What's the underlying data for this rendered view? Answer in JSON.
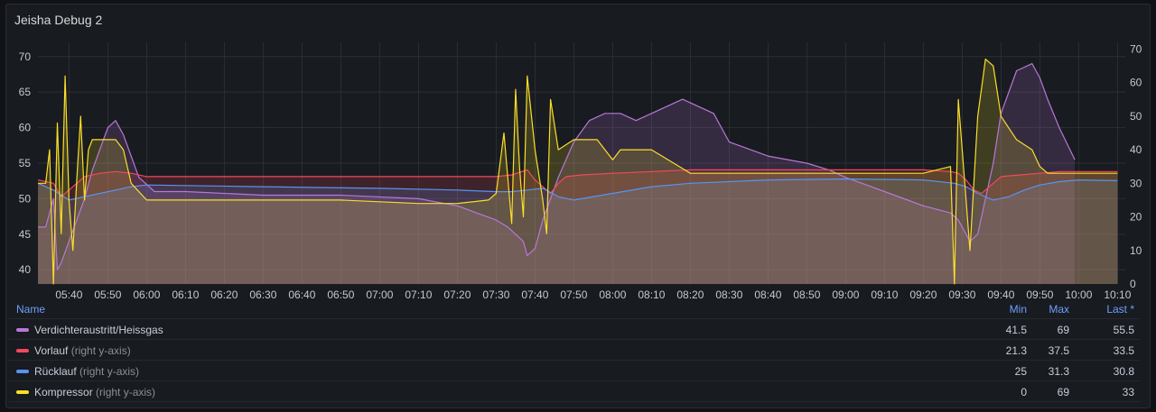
{
  "panel": {
    "title": "Jeisha Debug 2"
  },
  "legend": {
    "headers": {
      "name": "Name",
      "min": "Min",
      "max": "Max",
      "last": "Last *"
    },
    "rows": [
      {
        "name": "Verdichteraustritt/Heissgas",
        "axis_note": "",
        "color": "#b877d9",
        "min": "41.5",
        "max": "69",
        "last": "55.5"
      },
      {
        "name": "Vorlauf",
        "axis_note": "(right y-axis)",
        "color": "#f2495c",
        "min": "21.3",
        "max": "37.5",
        "last": "33.5"
      },
      {
        "name": "Rücklauf",
        "axis_note": "(right y-axis)",
        "color": "#5794f2",
        "min": "25",
        "max": "31.3",
        "last": "30.8"
      },
      {
        "name": "Kompressor",
        "axis_note": "(right y-axis)",
        "color": "#fade2a",
        "min": "0",
        "max": "69",
        "last": "33"
      }
    ]
  },
  "chart_data": {
    "type": "line",
    "grid": true,
    "legend_placement": "bottom",
    "xlim": [
      "05:32",
      "10:12"
    ],
    "x_ticks": [
      "05:40",
      "05:50",
      "06:00",
      "06:10",
      "06:20",
      "06:30",
      "06:40",
      "06:50",
      "07:00",
      "07:10",
      "07:20",
      "07:30",
      "07:40",
      "07:50",
      "08:00",
      "08:10",
      "08:20",
      "08:30",
      "08:40",
      "08:50",
      "09:00",
      "09:10",
      "09:20",
      "09:30",
      "09:40",
      "09:50",
      "10:00",
      "10:10"
    ],
    "y_left": {
      "ylim": [
        38,
        72
      ],
      "ticks": [
        "40",
        "45",
        "50",
        "55",
        "60",
        "65",
        "70"
      ]
    },
    "y_right": {
      "ylim": [
        0,
        72
      ],
      "ticks": [
        "0",
        "10",
        "20",
        "30",
        "40",
        "50",
        "60",
        "70"
      ]
    },
    "series": [
      {
        "name": "Verdichteraustritt/Heissgas",
        "axis": "left",
        "color": "#b877d9",
        "x": [
          "05:32",
          "05:34",
          "05:36",
          "05:37",
          "05:38",
          "05:40",
          "05:42",
          "05:44",
          "05:46",
          "05:48",
          "05:50",
          "05:52",
          "05:54",
          "05:56",
          "05:58",
          "06:00",
          "06:02",
          "06:10",
          "06:30",
          "06:50",
          "07:10",
          "07:20",
          "07:25",
          "07:30",
          "07:33",
          "07:35",
          "07:37",
          "07:38",
          "07:40",
          "07:42",
          "07:44",
          "07:46",
          "07:50",
          "07:54",
          "07:58",
          "08:02",
          "08:06",
          "08:10",
          "08:14",
          "08:18",
          "08:22",
          "08:26",
          "08:30",
          "08:40",
          "08:50",
          "08:56",
          "09:00",
          "09:05",
          "09:10",
          "09:20",
          "09:27",
          "09:29",
          "09:30",
          "09:32",
          "09:34",
          "09:36",
          "09:38",
          "09:40",
          "09:44",
          "09:48",
          "09:50",
          "09:52",
          "09:55",
          "09:59"
        ],
        "y": [
          46,
          46,
          50,
          40,
          41,
          44,
          47,
          50,
          54,
          57,
          60,
          61,
          59,
          56,
          53,
          52,
          51,
          51,
          50.5,
          50.5,
          50,
          49,
          48,
          47,
          46,
          45,
          44,
          42,
          43,
          47,
          50,
          53,
          58,
          61,
          62,
          62,
          61,
          62,
          63,
          64,
          63,
          62,
          58,
          56,
          55,
          54,
          53,
          52,
          51,
          49,
          48,
          47,
          46,
          44,
          45,
          50,
          55,
          62,
          68,
          69,
          67,
          64,
          60,
          55.5
        ]
      },
      {
        "name": "Vorlauf",
        "axis": "right",
        "color": "#f2495c",
        "x": [
          "05:32",
          "05:36",
          "05:38",
          "05:40",
          "05:44",
          "05:48",
          "05:52",
          "05:56",
          "06:00",
          "06:30",
          "07:00",
          "07:30",
          "07:34",
          "07:38",
          "07:40",
          "07:42",
          "07:44",
          "07:46",
          "07:48",
          "07:52",
          "08:00",
          "08:10",
          "08:20",
          "08:40",
          "09:00",
          "09:20",
          "09:27",
          "09:29",
          "09:31",
          "09:33",
          "09:35",
          "09:37",
          "09:40",
          "09:45",
          "09:50",
          "09:55",
          "10:00",
          "10:05",
          "10:10"
        ],
        "y": [
          31,
          30,
          26,
          28,
          32,
          33,
          33.5,
          33,
          32,
          32,
          32,
          32,
          32.5,
          34,
          31,
          29,
          27,
          30,
          32,
          32.5,
          33,
          33.5,
          34,
          34,
          34,
          34,
          33.5,
          33,
          31,
          28,
          27,
          29,
          32,
          32.5,
          33,
          33.5,
          33.5,
          33.5,
          33.5
        ]
      },
      {
        "name": "Rücklauf",
        "axis": "right",
        "color": "#5794f2",
        "x": [
          "05:32",
          "05:36",
          "05:40",
          "05:44",
          "05:48",
          "05:52",
          "05:56",
          "06:00",
          "06:30",
          "07:00",
          "07:20",
          "07:30",
          "07:34",
          "07:38",
          "07:42",
          "07:46",
          "07:50",
          "08:00",
          "08:10",
          "08:20",
          "08:40",
          "09:00",
          "09:20",
          "09:28",
          "09:31",
          "09:34",
          "09:38",
          "09:42",
          "09:46",
          "09:50",
          "09:55",
          "10:00",
          "10:10"
        ],
        "y": [
          30,
          28,
          25,
          26,
          27,
          28,
          29,
          29.5,
          29,
          28.5,
          28,
          27.5,
          27.5,
          28,
          28.5,
          26,
          25,
          27,
          29,
          30,
          31,
          31.3,
          31,
          30,
          29,
          27,
          25,
          26,
          28,
          29.5,
          30.5,
          31,
          30.8
        ]
      },
      {
        "name": "Kompressor",
        "axis": "right",
        "color": "#fade2a",
        "x": [
          "05:32",
          "05:34",
          "05:35",
          "05:36",
          "05:37",
          "05:38",
          "05:39",
          "05:40",
          "05:41",
          "05:42",
          "05:43",
          "05:44",
          "05:45",
          "05:46",
          "05:52",
          "05:54",
          "05:56",
          "06:00",
          "06:10",
          "06:30",
          "06:50",
          "07:10",
          "07:20",
          "07:28",
          "07:30",
          "07:32",
          "07:34",
          "07:35",
          "07:36",
          "07:37",
          "07:38",
          "07:40",
          "07:42",
          "07:43",
          "07:44",
          "07:46",
          "07:50",
          "07:56",
          "08:00",
          "08:02",
          "08:10",
          "08:20",
          "08:30",
          "08:40",
          "08:50",
          "09:00",
          "09:10",
          "09:20",
          "09:27",
          "09:28",
          "09:29",
          "09:30",
          "09:31",
          "09:32",
          "09:34",
          "09:36",
          "09:38",
          "09:40",
          "09:44",
          "09:48",
          "09:50",
          "09:52",
          "09:56",
          "10:00",
          "10:05",
          "10:10"
        ],
        "y": [
          30,
          30,
          40,
          0,
          48,
          15,
          62,
          25,
          10,
          31,
          50,
          25,
          40,
          43,
          43,
          40,
          30,
          25,
          25,
          25,
          25,
          24,
          24,
          25,
          27,
          45,
          18,
          58,
          35,
          20,
          62,
          40,
          25,
          15,
          55,
          40,
          43,
          43,
          37,
          40,
          40,
          33,
          33,
          33,
          33,
          33,
          33,
          33,
          35,
          0,
          55,
          40,
          25,
          10,
          50,
          67,
          65,
          50,
          43,
          40,
          35,
          33,
          33,
          33,
          33,
          33
        ]
      }
    ]
  }
}
